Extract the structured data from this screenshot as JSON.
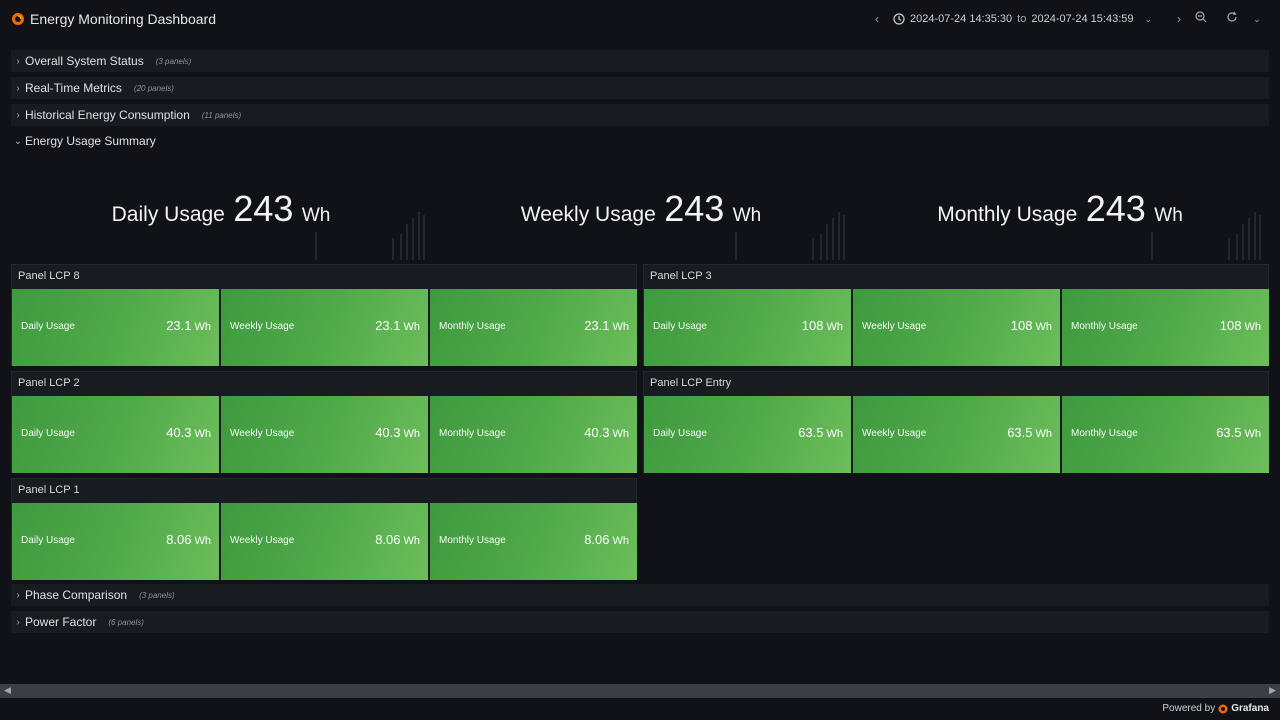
{
  "header": {
    "title": "Energy Monitoring Dashboard",
    "time_from": "2024-07-24 14:35:30",
    "time_sep": "to",
    "time_to": "2024-07-24 15:43:59"
  },
  "rows": [
    {
      "title": "Overall System Status",
      "count": "(3 panels)"
    },
    {
      "title": "Real-Time Metrics",
      "count": "(20 panels)"
    },
    {
      "title": "Historical Energy Consumption",
      "count": "(11 panels)"
    },
    {
      "title": "Energy Usage Summary",
      "count": ""
    },
    {
      "title": "Phase Comparison",
      "count": "(3 panels)"
    },
    {
      "title": "Power Factor",
      "count": "(6 panels)"
    }
  ],
  "summary": [
    {
      "label": "Daily Usage",
      "value": "243",
      "unit": "Wh"
    },
    {
      "label": "Weekly Usage",
      "value": "243",
      "unit": "Wh"
    },
    {
      "label": "Monthly Usage",
      "value": "243",
      "unit": "Wh"
    }
  ],
  "panels": [
    {
      "title": "Panel LCP 8",
      "tiles": [
        {
          "label": "Daily Usage",
          "value": "23.1",
          "unit": "Wh"
        },
        {
          "label": "Weekly Usage",
          "value": "23.1",
          "unit": "Wh"
        },
        {
          "label": "Monthly Usage",
          "value": "23.1",
          "unit": "Wh"
        }
      ]
    },
    {
      "title": "Panel LCP 3",
      "tiles": [
        {
          "label": "Daily Usage",
          "value": "108",
          "unit": "Wh"
        },
        {
          "label": "Weekly Usage",
          "value": "108",
          "unit": "Wh"
        },
        {
          "label": "Monthly Usage",
          "value": "108",
          "unit": "Wh"
        }
      ]
    },
    {
      "title": "Panel LCP 2",
      "tiles": [
        {
          "label": "Daily Usage",
          "value": "40.3",
          "unit": "Wh"
        },
        {
          "label": "Weekly Usage",
          "value": "40.3",
          "unit": "Wh"
        },
        {
          "label": "Monthly Usage",
          "value": "40.3",
          "unit": "Wh"
        }
      ]
    },
    {
      "title": "Panel LCP Entry",
      "tiles": [
        {
          "label": "Daily Usage",
          "value": "63.5",
          "unit": "Wh"
        },
        {
          "label": "Weekly Usage",
          "value": "63.5",
          "unit": "Wh"
        },
        {
          "label": "Monthly Usage",
          "value": "63.5",
          "unit": "Wh"
        }
      ]
    },
    {
      "title": "Panel LCP 1",
      "tiles": [
        {
          "label": "Daily Usage",
          "value": "8.06",
          "unit": "Wh"
        },
        {
          "label": "Weekly Usage",
          "value": "8.06",
          "unit": "Wh"
        },
        {
          "label": "Monthly Usage",
          "value": "8.06",
          "unit": "Wh"
        }
      ]
    }
  ],
  "footer": {
    "powered_by": "Powered by",
    "brand": "Grafana"
  },
  "colors": {
    "background": "#111217",
    "row_background": "#181b1f",
    "tile_green": "#4fa949",
    "logo_orange": "#f46800"
  },
  "icons": {
    "logo": "grafana-logo-icon",
    "time_back": "chevron-left-icon",
    "clock": "clock-icon",
    "time_dropdown": "chevron-down-icon",
    "time_forward": "chevron-right-icon",
    "zoom_out": "zoom-out-icon",
    "refresh": "refresh-icon",
    "refresh_dropdown": "chevron-down-icon"
  }
}
